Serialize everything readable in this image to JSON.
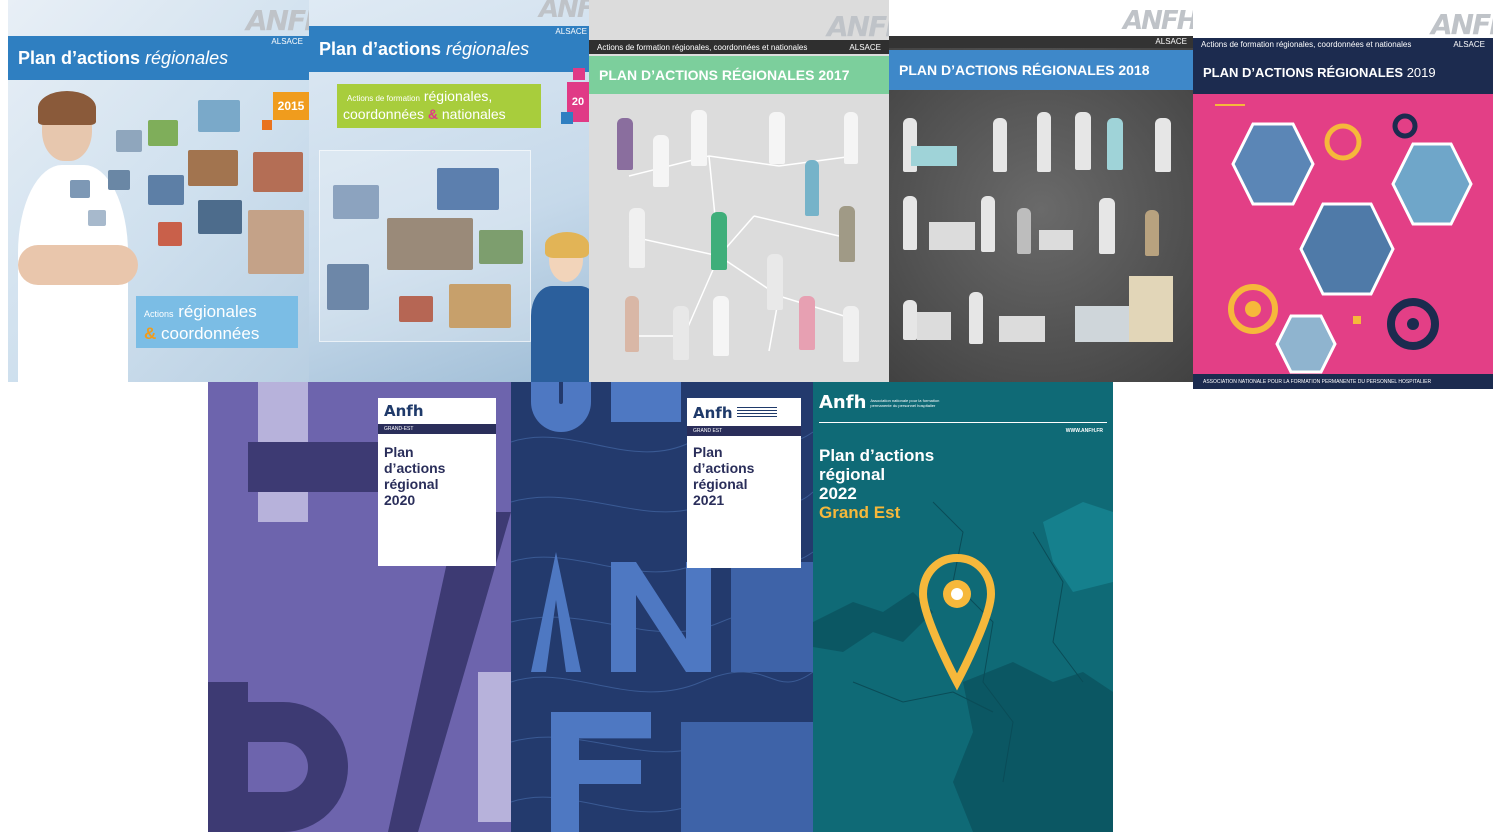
{
  "covers": {
    "c2015": {
      "logo": "ANFH",
      "region": "ALSACE",
      "title_bold": "Plan d’actions",
      "title_italic": "régionales",
      "year": "2015",
      "tag_small": "Actions",
      "tag_line1": "régionales",
      "tag_amp": "&",
      "tag_line2": "coordonnées"
    },
    "c2016": {
      "logo": "ANFH",
      "region": "ALSACE",
      "title_bold": "Plan d’actions",
      "title_italic": "régionales",
      "year": "20",
      "tag_small": "Actions de formation",
      "tag_line1": "régionales,",
      "tag_line2a": "coordonnées",
      "tag_amp": "&",
      "tag_line2b": "nationales"
    },
    "c2017": {
      "logo": "ANFH",
      "strip_left": "Actions de formation régionales, coordonnées et nationales",
      "region": "ALSACE",
      "title": "PLAN D’ACTIONS RÉGIONALES 2017"
    },
    "c2018": {
      "logo": "ANFH",
      "region": "ALSACE",
      "title": "PLAN D’ACTIONS RÉGIONALES 2018"
    },
    "c2019": {
      "logo": "ANFH",
      "strip_left": "Actions de formation régionales, coordonnées et nationales",
      "region": "ALSACE",
      "title_bold": "PLAN D’ACTIONS RÉGIONALES",
      "year": "2019",
      "footer": "ASSOCIATION NATIONALE POUR LA FORMATION PERMANENTE DU PERSONNEL HOSPITALIER"
    },
    "c2020": {
      "logo": "Anfh",
      "region": "GRAND-EST",
      "line1": "Plan",
      "line2": "d’actions",
      "line3": "régional",
      "line4": "2020"
    },
    "c2021": {
      "logo": "Anfh",
      "region": "GRAND EST",
      "line1": "Plan",
      "line2": "d’actions",
      "line3": "régional",
      "line4": "2021"
    },
    "c2022": {
      "logo": "Anfh",
      "logo_sub": "Association nationale pour la formation permanente du personnel hospitalier",
      "website": "WWW.ANFH.FR",
      "line1": "Plan d’actions",
      "line2": "régional",
      "line3": "2022",
      "line4": "Grand Est"
    }
  },
  "icons": [
    "map-pin-icon",
    "gear-icon"
  ],
  "colors": {
    "blue_band": "#2f7fc1",
    "green_band": "#7ccf9c",
    "dark_band": "#2c2c2c",
    "navy_band": "#1c2b4f",
    "pink_bg": "#e33f86",
    "purple_bg": "#6d64ad",
    "navy_bg": "#233a6d",
    "teal_bg": "#0f6a76",
    "yellow_pin": "#f6b83b"
  }
}
